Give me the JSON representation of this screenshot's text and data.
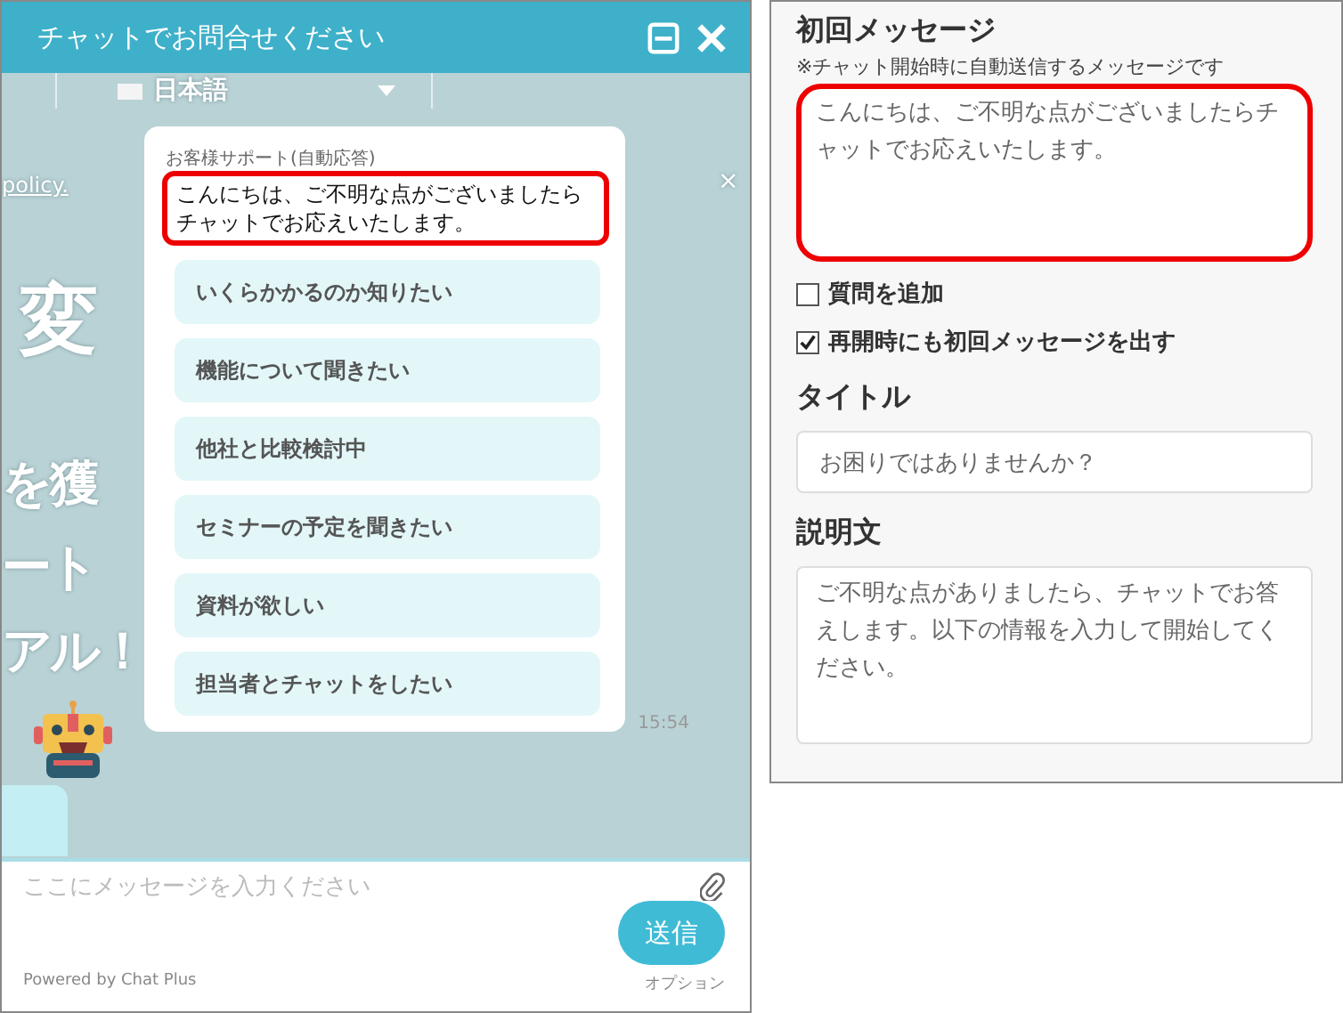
{
  "chat_widget": {
    "title": "チャットでお問合せください",
    "background_page": {
      "language": "日本語",
      "link": "policy.",
      "close": "×",
      "headline": "変",
      "lines": [
        "を獲",
        "ート",
        "アル！"
      ]
    },
    "bot_message": {
      "sender": "お客様サポート(自動応答)",
      "text": "こんにちは、ご不明な点がございましたらチャットでお応えいたします。",
      "highlighted": true,
      "options": [
        "いくらかかるのか知りたい",
        "機能について聞きたい",
        "他社と比較検討中",
        "セミナーの予定を聞きたい",
        "資料が欲しい",
        "担当者とチャットをしたい"
      ],
      "time": "15:54"
    },
    "input": {
      "placeholder": "ここにメッセージを入力ください"
    },
    "send_button": "送信",
    "powered_by": "Powered by Chat Plus",
    "options_link": "オプション"
  },
  "settings": {
    "first_message": {
      "heading": "初回メッセージ",
      "note": "※チャット開始時に自動送信するメッセージです",
      "value": "こんにちは、ご不明な点がございましたらチャットでお応えいたします。",
      "highlighted": true
    },
    "checkboxes": [
      {
        "label": "質問を追加",
        "checked": false
      },
      {
        "label": "再開時にも初回メッセージを出す",
        "checked": true
      }
    ],
    "title_field": {
      "heading": "タイトル",
      "value": "お困りではありませんか？"
    },
    "description_field": {
      "heading": "説明文",
      "value": "ご不明な点がありましたら、チャットでお答えします。以下の情報を入力して開始してください。"
    }
  }
}
